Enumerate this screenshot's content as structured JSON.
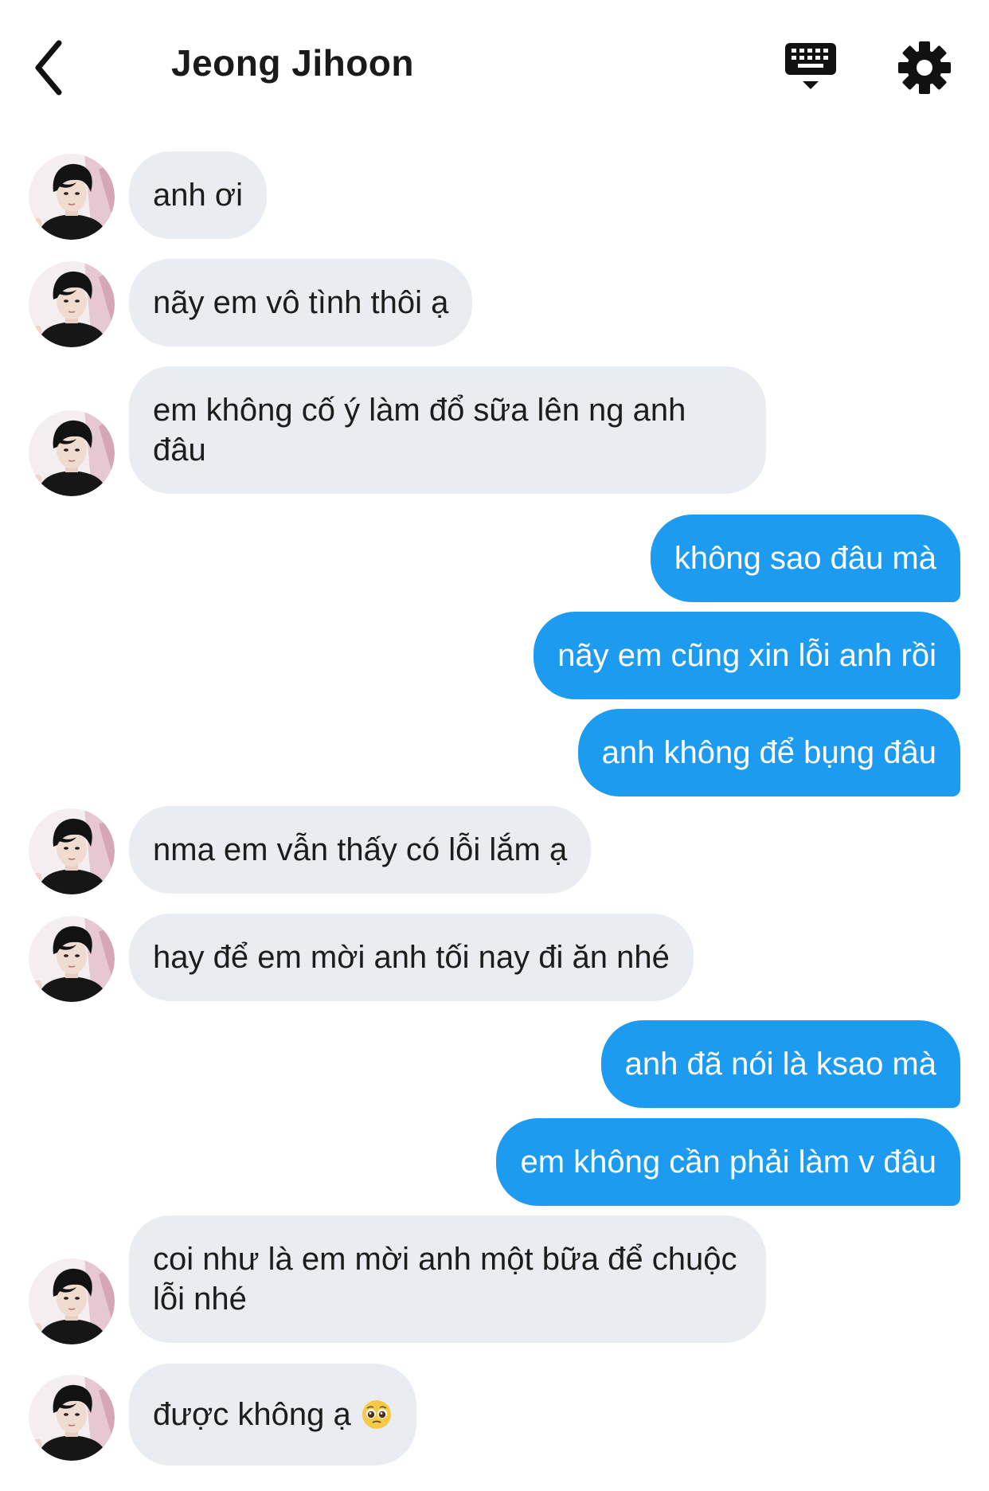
{
  "header": {
    "title": "Jeong Jihoon",
    "back_icon": "chevron-left-icon",
    "keyboard_icon": "keyboard-icon",
    "settings_icon": "gear-icon"
  },
  "colors": {
    "incoming_bubble": "#e9ecf0",
    "outgoing_bubble": "#1d9bf0",
    "outgoing_text": "#ffffff"
  },
  "messages": [
    {
      "direction": "incoming",
      "text": "anh ơi"
    },
    {
      "direction": "incoming",
      "text": "nãy em vô tình thôi ạ"
    },
    {
      "direction": "incoming",
      "text": "em không cố ý làm đổ sữa lên ng anh đâu"
    },
    {
      "direction": "outgoing",
      "text": "không sao đâu mà"
    },
    {
      "direction": "outgoing",
      "text": "nãy em cũng xin lỗi anh rồi"
    },
    {
      "direction": "outgoing",
      "text": "anh không để bụng đâu"
    },
    {
      "direction": "incoming",
      "text": "nma em vẫn thấy có lỗi lắm ạ"
    },
    {
      "direction": "incoming",
      "text": "hay để em mời anh tối nay đi ăn nhé"
    },
    {
      "direction": "outgoing",
      "text": "anh đã nói là ksao mà"
    },
    {
      "direction": "outgoing",
      "text": "em không cần phải làm v đâu"
    },
    {
      "direction": "incoming",
      "text": "coi như là em mời anh một bữa để chuộc lỗi nhé"
    },
    {
      "direction": "incoming",
      "text": "được không ạ",
      "emoji": "pleading-face-emoji"
    }
  ]
}
